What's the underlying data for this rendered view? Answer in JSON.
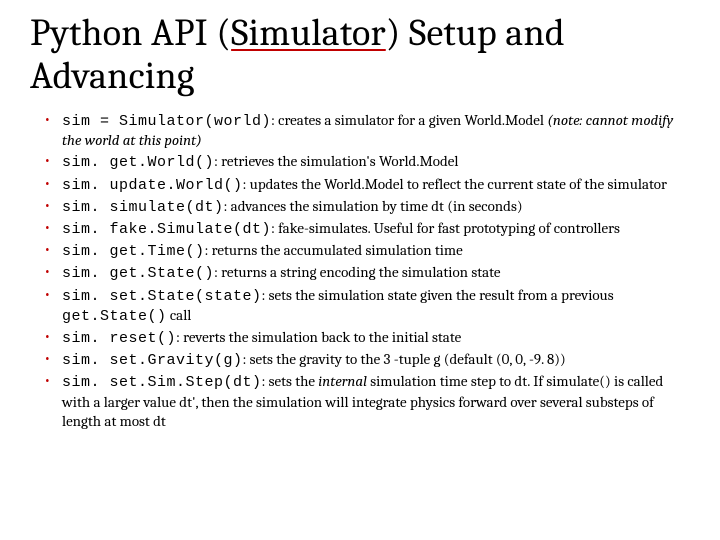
{
  "title": {
    "pre": "Python API (",
    "link": "Simulator",
    "post": ") Setup and Advancing"
  },
  "items": [
    {
      "code": "sim = Simulator(world)",
      "desc": ": creates a simulator for a given World.Model ",
      "note": "(note: cannot modify the world at this point)"
    },
    {
      "code": "sim. get.World()",
      "desc": ": retrieves the simulation's World.Model"
    },
    {
      "code": "sim. update.World()",
      "desc": ": updates the World.Model to reflect the current state of the simulator"
    },
    {
      "code": "sim. simulate(dt)",
      "desc": ": advances the simulation by time dt (in seconds)"
    },
    {
      "code": "sim. fake.Simulate(dt)",
      "desc": ": fake-simulates.  Useful for fast prototyping of controllers"
    },
    {
      "code": "sim. get.Time()",
      "desc": ": returns the accumulated simulation time"
    },
    {
      "code": "sim. get.State()",
      "desc": ": returns a string encoding the simulation state"
    },
    {
      "code": "sim. set.State(state)",
      "desc": ": sets the simulation state given the result from a previous ",
      "code2": "get.State()",
      "desc2": " call"
    },
    {
      "code": "sim. reset()",
      "desc": ": reverts the simulation back to the initial state"
    },
    {
      "code": "sim. set.Gravity(g)",
      "desc": ": sets the gravity to the 3 -tuple g (default (0, 0, -9. 8))"
    },
    {
      "code": "sim. set.Sim.Step(dt)",
      "desc": ": sets the ",
      "italic": "internal",
      "desc2": " simulation time step to dt. If simulate() is called with a larger value dt', then the simulation will integrate physics forward over several substeps of length at most dt"
    }
  ]
}
